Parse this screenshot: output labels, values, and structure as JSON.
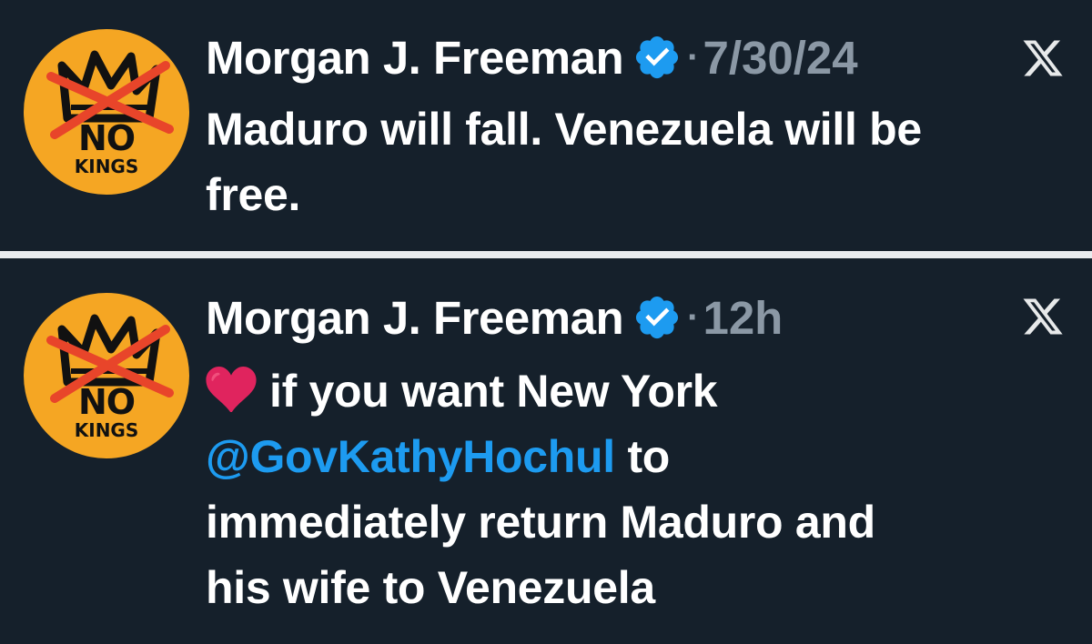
{
  "colors": {
    "background": "#15202b",
    "separator": "#e9ecef",
    "text": "#ffffff",
    "muted": "#8b98a5",
    "link": "#1d9bf0",
    "verified": "#1d9bf0",
    "avatar_bg": "#f5a623",
    "avatar_cross": "#e8452a",
    "heart": "#e0245e"
  },
  "posts": [
    {
      "avatar": {
        "line1": "NO",
        "line2": "KINGS",
        "icon": "no-kings-crown-avatar"
      },
      "display_name": "Morgan J. Freeman",
      "verified_icon": "verified-badge-icon",
      "separator_dot": "·",
      "timestamp": "7/30/24",
      "platform_icon": "x-logo-icon",
      "text_lines": [
        "Maduro will fall. Venezuela will be",
        "free."
      ]
    },
    {
      "avatar": {
        "line1": "NO",
        "line2": "KINGS",
        "icon": "no-kings-crown-avatar"
      },
      "display_name": "Morgan J. Freeman",
      "verified_icon": "verified-badge-icon",
      "separator_dot": "·",
      "timestamp": "12h",
      "platform_icon": "x-logo-icon",
      "emoji": "red-heart-emoji",
      "text_parts": {
        "line1_after_emoji": "if you want New York",
        "mention": "@GovKathyHochul",
        "after_mention": " to",
        "line3": "immediately return Maduro and",
        "line4": "his wife to Venezuela"
      }
    }
  ]
}
